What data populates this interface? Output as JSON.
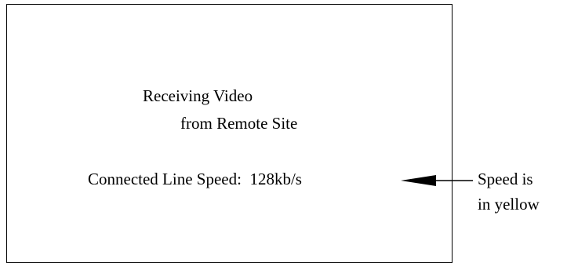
{
  "screen": {
    "line1": "Receiving Video",
    "line2": "from Remote Site",
    "speed_label": "Connected Line Speed:",
    "speed_value": "128kb/s"
  },
  "annotation": {
    "line1": "Speed is",
    "line2": "in yellow"
  }
}
